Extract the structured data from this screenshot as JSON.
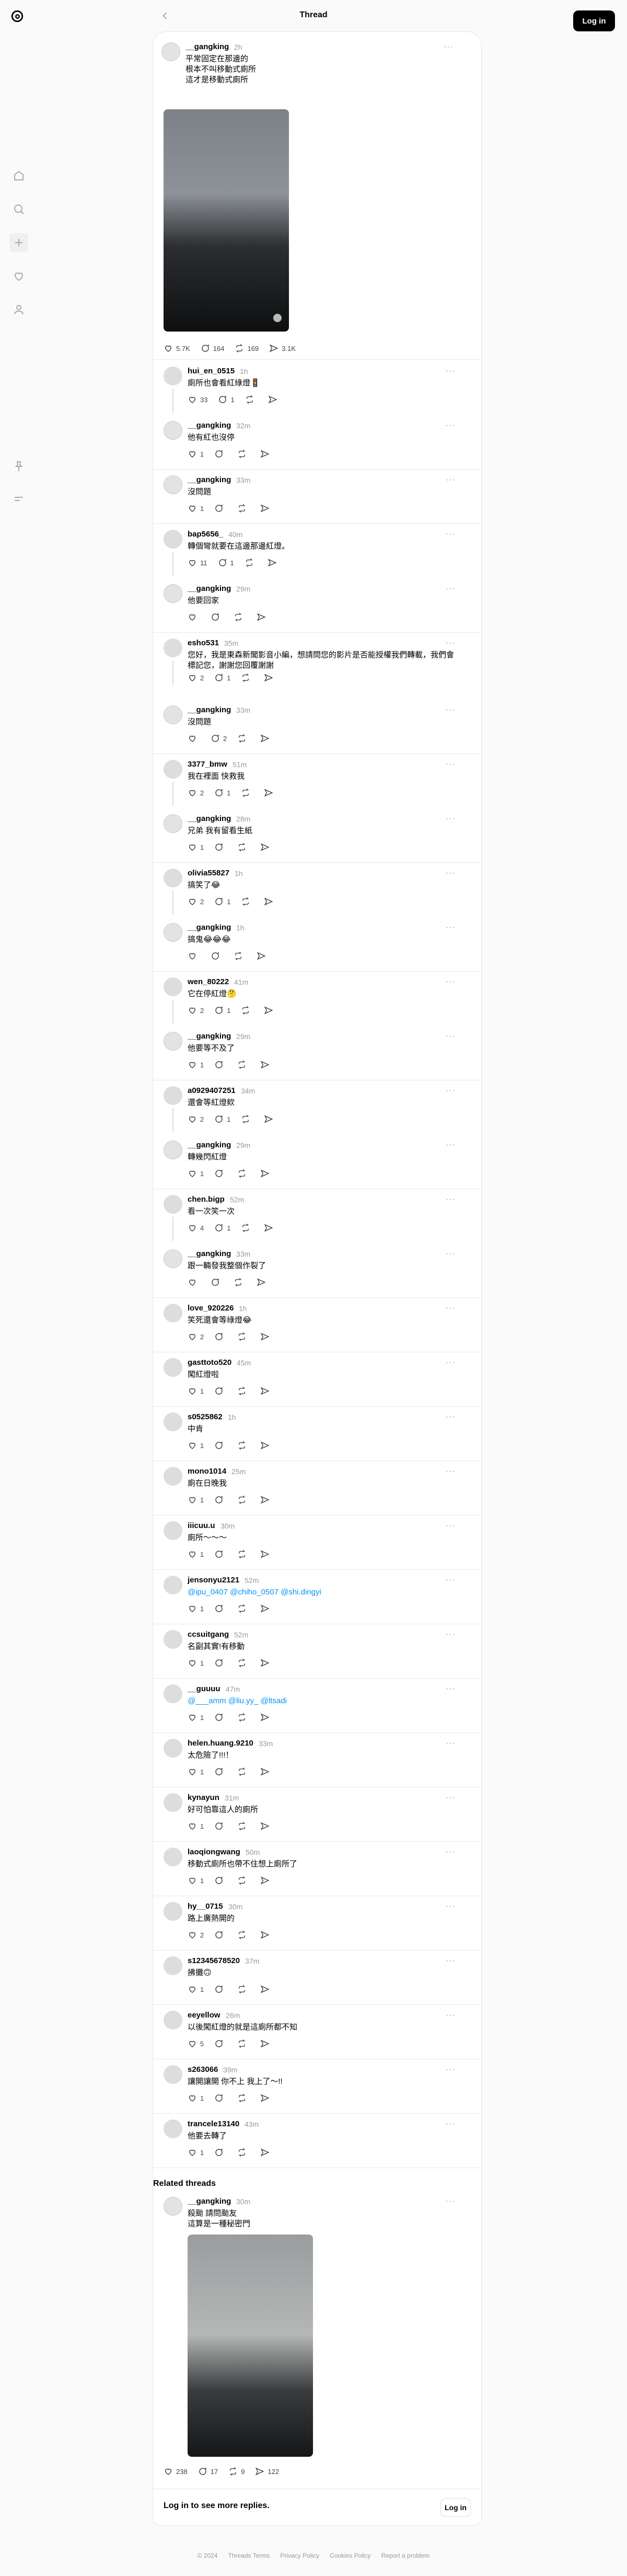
{
  "header": {
    "title": "Thread",
    "login_label": "Log in"
  },
  "main_post": {
    "user": "__gangking",
    "time": "2h",
    "text": "平常固定在那邊的\n根本不叫移動式廁所\n這才是移動式廁所",
    "likes": "5.7K",
    "comments": "164",
    "reposts": "169",
    "shares": "3.1K"
  },
  "replies": [
    {
      "user": "hui_en_0515",
      "time": "1h",
      "text": "廁所也會看紅綠燈🚦",
      "likes": "33",
      "comments": "1",
      "reposts": "",
      "shares": "",
      "is_op": false
    },
    {
      "user": "__gangking",
      "time": "32m",
      "text": "他有紅也沒停",
      "likes": "1",
      "comments": "",
      "reposts": "",
      "shares": "",
      "is_op": true
    },
    {
      "user": "__gangking",
      "time": "33m",
      "text": "沒問題",
      "likes": "1",
      "comments": "",
      "reposts": "",
      "shares": "",
      "is_op": true
    },
    {
      "user": "bap5656_",
      "time": "40m",
      "text": "轉個彎就要在這邊那邊紅燈。",
      "likes": "11",
      "comments": "1",
      "reposts": "",
      "shares": "",
      "is_op": false
    },
    {
      "user": "__gangking",
      "time": "29m",
      "text": "他要回家",
      "likes": "",
      "comments": "",
      "reposts": "",
      "shares": "",
      "is_op": true
    },
    {
      "user": "esho531",
      "time": "35m",
      "text": "您好，我是東森新聞影音小編，想請問您的影片是否能授權我們轉載，我們會標記您，謝謝您回覆謝謝",
      "likes": "2",
      "comments": "1",
      "reposts": "",
      "shares": "",
      "is_op": false
    },
    {
      "user": "__gangking",
      "time": "33m",
      "text": "沒問題",
      "likes": "",
      "comments": "2",
      "reposts": "",
      "shares": "",
      "is_op": true
    },
    {
      "user": "3377_bmw",
      "time": "51m",
      "text": "我在裡面 快救我",
      "likes": "2",
      "comments": "1",
      "reposts": "",
      "shares": "",
      "is_op": false
    },
    {
      "user": "__gangking",
      "time": "28m",
      "text": "兄弟 我有留看生紙",
      "likes": "1",
      "comments": "",
      "reposts": "",
      "shares": "",
      "is_op": true
    },
    {
      "user": "olivia55827",
      "time": "1h",
      "text": "搞笑了😂",
      "likes": "2",
      "comments": "1",
      "reposts": "",
      "shares": "",
      "is_op": false
    },
    {
      "user": "__gangking",
      "time": "1h",
      "text": "搞鬼😂😂😂",
      "likes": "",
      "comments": "",
      "reposts": "",
      "shares": "",
      "is_op": true
    },
    {
      "user": "wen_80222",
      "time": "41m",
      "text": "它在停紅燈🤔",
      "likes": "2",
      "comments": "1",
      "reposts": "",
      "shares": "",
      "is_op": false
    },
    {
      "user": "__gangking",
      "time": "29m",
      "text": "他要等不及了",
      "likes": "1",
      "comments": "",
      "reposts": "",
      "shares": "",
      "is_op": true
    },
    {
      "user": "a0929407251",
      "time": "34m",
      "text": "還會等紅燈欸",
      "likes": "2",
      "comments": "1",
      "reposts": "",
      "shares": "",
      "is_op": false
    },
    {
      "user": "__gangking",
      "time": "29m",
      "text": "轉幾閃紅燈",
      "likes": "1",
      "comments": "",
      "reposts": "",
      "shares": "",
      "is_op": true
    },
    {
      "user": "chen.bigp",
      "time": "52m",
      "text": "看一次笑一次",
      "likes": "4",
      "comments": "1",
      "reposts": "",
      "shares": "",
      "is_op": false
    },
    {
      "user": "__gangking",
      "time": "33m",
      "text": "跟一輛發我整個作裂了",
      "likes": "",
      "comments": "",
      "reposts": "",
      "shares": "",
      "is_op": true
    },
    {
      "user": "love_920226",
      "time": "1h",
      "text": "笑死還會等綠燈😂",
      "likes": "2",
      "comments": "",
      "reposts": "",
      "shares": "",
      "is_op": false
    },
    {
      "user": "gasttoto520",
      "time": "45m",
      "text": "闖紅燈啦",
      "likes": "1",
      "comments": "",
      "reposts": "",
      "shares": "",
      "is_op": false
    },
    {
      "user": "s0525862",
      "time": "1h",
      "text": "中肯",
      "likes": "1",
      "comments": "",
      "reposts": "",
      "shares": "",
      "is_op": false
    },
    {
      "user": "mono1014",
      "time": "25m",
      "text": "廁在日晚我",
      "likes": "1",
      "comments": "",
      "reposts": "",
      "shares": "",
      "is_op": false
    },
    {
      "user": "iiicuu.u",
      "time": "30m",
      "text": "廁所～～～",
      "likes": "1",
      "comments": "",
      "reposts": "",
      "shares": "",
      "is_op": false
    },
    {
      "user": "jensonyu2121",
      "time": "52m",
      "text": "@ipu_0407 @chiho_0507 @shi.dingyi",
      "likes": "1",
      "comments": "",
      "reposts": "",
      "shares": "",
      "is_op": false,
      "link": true
    },
    {
      "user": "ccsuitgang",
      "time": "52m",
      "text": "名副其實!有移動",
      "likes": "1",
      "comments": "",
      "reposts": "",
      "shares": "",
      "is_op": false
    },
    {
      "user": "__guuuu",
      "time": "47m",
      "text": "@___amm @liu.yy_ @ltsadi",
      "likes": "1",
      "comments": "",
      "reposts": "",
      "shares": "",
      "is_op": false,
      "link": true
    },
    {
      "user": "helen.huang.9210",
      "time": "33m",
      "text": "太危險了!!!！",
      "likes": "1",
      "comments": "",
      "reposts": "",
      "shares": "",
      "is_op": false
    },
    {
      "user": "kynayun",
      "time": "31m",
      "text": "好可怕靠這人的廁所",
      "likes": "1",
      "comments": "",
      "reposts": "",
      "shares": "",
      "is_op": false
    },
    {
      "user": "laoqiongwang",
      "time": "50m",
      "text": "移動式廁所也帶不住想上廁所了",
      "likes": "1",
      "comments": "",
      "reposts": "",
      "shares": "",
      "is_op": false
    },
    {
      "user": "hy__0715",
      "time": "30m",
      "text": "路上廣熱開的",
      "likes": "2",
      "comments": "",
      "reposts": "",
      "shares": "",
      "is_op": false
    },
    {
      "user": "s12345678520",
      "time": "37m",
      "text": "拂攤🙃",
      "likes": "1",
      "comments": "",
      "reposts": "",
      "shares": "",
      "is_op": false
    },
    {
      "user": "eeyellow",
      "time": "26m",
      "text": "以後闖紅燈的就是這廁所都不知",
      "likes": "5",
      "comments": "",
      "reposts": "",
      "shares": "",
      "is_op": false
    },
    {
      "user": "s263066",
      "time": "39m",
      "text": "讓開讓開 你不上 我上了～!!",
      "likes": "1",
      "comments": "",
      "reposts": "",
      "shares": "",
      "is_op": false
    },
    {
      "user": "trancele13140",
      "time": "43m",
      "text": "他要去轉了",
      "likes": "1",
      "comments": "",
      "reposts": "",
      "shares": "",
      "is_op": false
    }
  ],
  "related": {
    "heading": "Related threads",
    "user": "__gangking",
    "time": "30m",
    "text": "殺颱 請問颱友\n這算是一種秘密門",
    "likes": "238",
    "comments": "17",
    "reposts": "9",
    "shares": "122"
  },
  "login_bar": {
    "text": "Log in to see more replies.",
    "button": "Log in"
  },
  "footer": [
    "© 2024",
    "Threads Terms",
    "Privacy Policy",
    "Cookies Policy",
    "Report a problem"
  ]
}
